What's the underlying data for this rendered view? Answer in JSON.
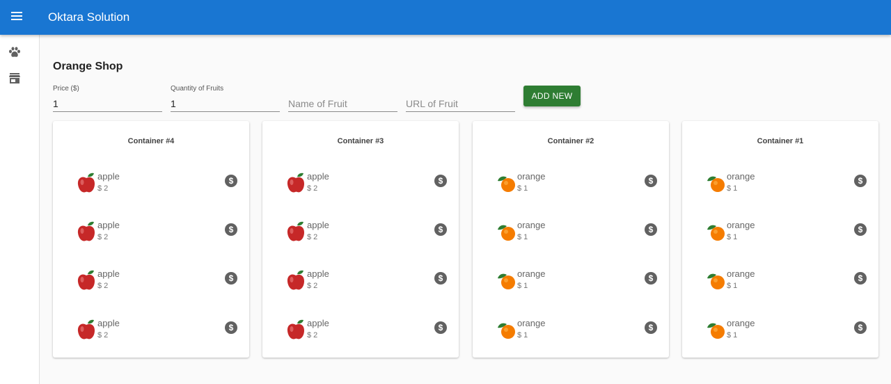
{
  "app": {
    "title": "Oktara Solution"
  },
  "sidebar": {
    "items": [
      {
        "icon": "paw-icon"
      },
      {
        "icon": "store-icon"
      }
    ]
  },
  "page": {
    "title": "Orange Shop"
  },
  "form": {
    "price": {
      "label": "Price ($)",
      "value": "1"
    },
    "quantity": {
      "label": "Quantity of Fruits",
      "value": "1"
    },
    "name": {
      "placeholder": "Name of Fruit",
      "value": ""
    },
    "url": {
      "placeholder": "URL of Fruit",
      "value": ""
    },
    "add_label": "ADD NEW"
  },
  "colors": {
    "appbar": "#1976d2",
    "add_button": "#2e7d32",
    "buy_icon": "#616161"
  },
  "containers": [
    {
      "title": "Container #4",
      "items": [
        {
          "name": "apple",
          "price": "$ 2",
          "icon": "apple-icon"
        },
        {
          "name": "apple",
          "price": "$ 2",
          "icon": "apple-icon"
        },
        {
          "name": "apple",
          "price": "$ 2",
          "icon": "apple-icon"
        },
        {
          "name": "apple",
          "price": "$ 2",
          "icon": "apple-icon"
        }
      ]
    },
    {
      "title": "Container #3",
      "items": [
        {
          "name": "apple",
          "price": "$ 2",
          "icon": "apple-icon"
        },
        {
          "name": "apple",
          "price": "$ 2",
          "icon": "apple-icon"
        },
        {
          "name": "apple",
          "price": "$ 2",
          "icon": "apple-icon"
        },
        {
          "name": "apple",
          "price": "$ 2",
          "icon": "apple-icon"
        }
      ]
    },
    {
      "title": "Container #2",
      "items": [
        {
          "name": "orange",
          "price": "$ 1",
          "icon": "orange-icon"
        },
        {
          "name": "orange",
          "price": "$ 1",
          "icon": "orange-icon"
        },
        {
          "name": "orange",
          "price": "$ 1",
          "icon": "orange-icon"
        },
        {
          "name": "orange",
          "price": "$ 1",
          "icon": "orange-icon"
        }
      ]
    },
    {
      "title": "Container #1",
      "items": [
        {
          "name": "orange",
          "price": "$ 1",
          "icon": "orange-icon"
        },
        {
          "name": "orange",
          "price": "$ 1",
          "icon": "orange-icon"
        },
        {
          "name": "orange",
          "price": "$ 1",
          "icon": "orange-icon"
        },
        {
          "name": "orange",
          "price": "$ 1",
          "icon": "orange-icon"
        }
      ]
    }
  ]
}
